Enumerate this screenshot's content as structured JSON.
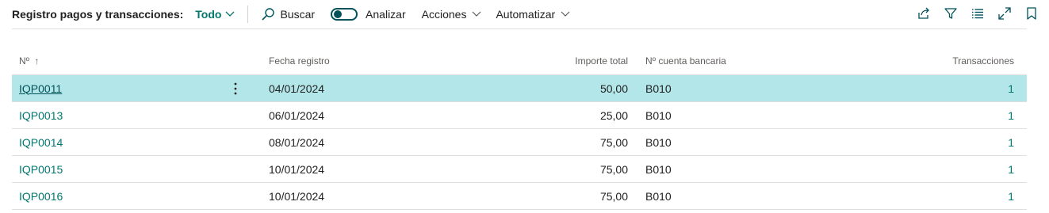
{
  "toolbar": {
    "title": "Registro pagos y transacciones:",
    "view": "Todo",
    "search_label": "Buscar",
    "analyze_label": "Analizar",
    "actions_label": "Acciones",
    "automate_label": "Automatizar",
    "analyze_on": false
  },
  "right_icons": [
    "share-icon",
    "filter-icon",
    "list-icon",
    "expand-icon",
    "bookmark-icon"
  ],
  "colors": {
    "accent": "#00776f",
    "selected_row": "#b3e6e9",
    "toggle": "#00525a"
  },
  "table": {
    "columns": {
      "no": "Nº",
      "date": "Fecha registro",
      "amount": "Importe total",
      "bank": "Nº cuenta bancaria",
      "transactions": "Transacciones"
    },
    "sort_indicator": "↑",
    "rows": [
      {
        "no": "IQP0011",
        "date": "04/01/2024",
        "amount": "50,00",
        "bank": "B010",
        "transactions": "1"
      },
      {
        "no": "IQP0013",
        "date": "06/01/2024",
        "amount": "25,00",
        "bank": "B010",
        "transactions": "1"
      },
      {
        "no": "IQP0014",
        "date": "08/01/2024",
        "amount": "75,00",
        "bank": "B010",
        "transactions": "1"
      },
      {
        "no": "IQP0015",
        "date": "10/01/2024",
        "amount": "75,00",
        "bank": "B010",
        "transactions": "1"
      },
      {
        "no": "IQP0016",
        "date": "10/01/2024",
        "amount": "75,00",
        "bank": "B010",
        "transactions": "1"
      }
    ]
  }
}
